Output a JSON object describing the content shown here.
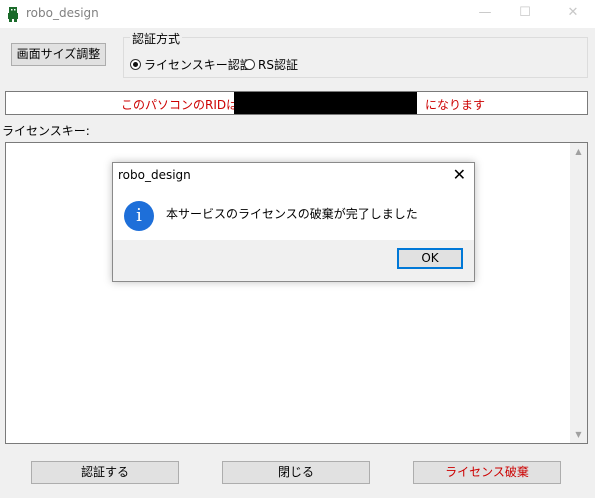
{
  "window": {
    "title": "robo_design",
    "minimize": "—",
    "maximize": "☐",
    "close": "✕"
  },
  "toolbar": {
    "resize_button": "画面サイズ調整"
  },
  "auth": {
    "group_title": "認証方式",
    "options": [
      {
        "label": "ライセンスキー認証",
        "checked": true
      },
      {
        "label": "RS認証",
        "checked": false
      }
    ]
  },
  "rid": {
    "prefix": "このパソコンのRIDは",
    "value": "",
    "suffix": "になります",
    "color": "#cc0000"
  },
  "license_key": {
    "label": "ライセンスキー:",
    "value": ""
  },
  "dialog": {
    "title": "robo_design",
    "message": "本サービスのライセンスの破棄が完了しました",
    "ok": "OK",
    "icon": "info-icon",
    "icon_glyph": "i"
  },
  "buttons": {
    "authenticate": "認証する",
    "close": "閉じる",
    "destroy": "ライセンス破棄",
    "destroy_color": "#cc0000"
  },
  "colors": {
    "accent": "#0078d7",
    "info_icon": "#1e6fd9"
  }
}
